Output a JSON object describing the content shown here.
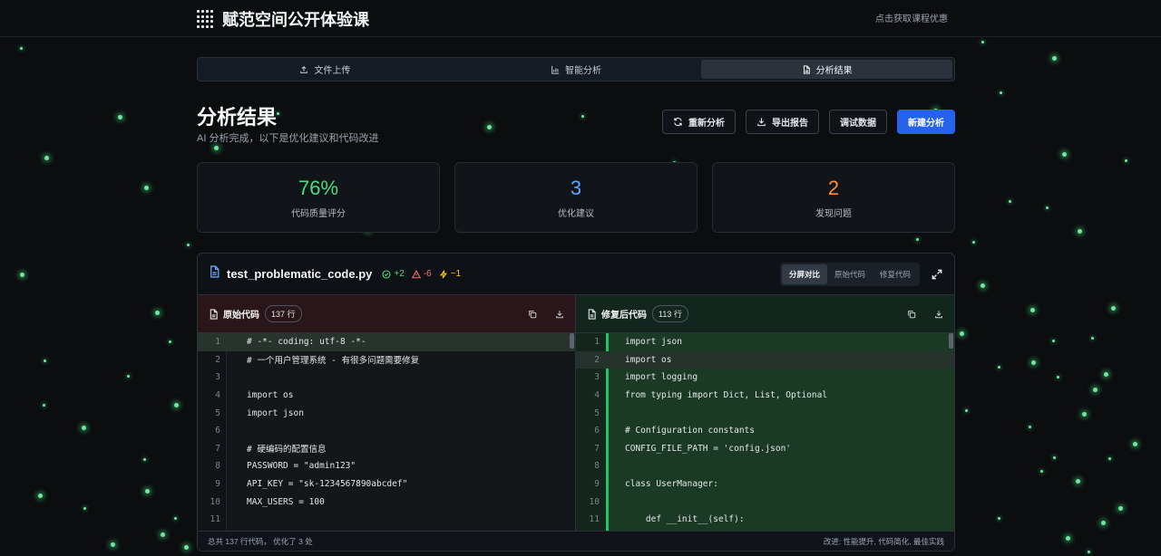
{
  "header": {
    "title": "赋范空间公开体验课",
    "link": "点击获取课程优惠"
  },
  "steps": [
    {
      "label": "文件上传",
      "icon": "upload-icon"
    },
    {
      "label": "智能分析",
      "icon": "bar-chart-icon"
    },
    {
      "label": "分析结果",
      "icon": "document-icon",
      "active": true
    }
  ],
  "page": {
    "title": "分析结果",
    "subtitle": "AI 分析完成，以下是优化建议和代码改进"
  },
  "actions": {
    "reanalyze": "重新分析",
    "export": "导出报告",
    "debug": "调试数据",
    "new": "新建分析"
  },
  "stats": [
    {
      "value": "76%",
      "label": "代码质量评分",
      "color": "#4ade80"
    },
    {
      "value": "3",
      "label": "优化建议",
      "color": "#60a5fa"
    },
    {
      "value": "2",
      "label": "发现问题",
      "color": "#fb923c"
    }
  ],
  "file": {
    "name": "test_problematic_code.py",
    "added": "+2",
    "removed": "-6",
    "changed": "~1",
    "views": [
      "分屏对比",
      "原始代码",
      "修复代码"
    ]
  },
  "left": {
    "title": "原始代码",
    "lines_badge": "137 行",
    "lines": [
      {
        "n": "1",
        "t": "# -*- coding: utf-8 -*-"
      },
      {
        "n": "2",
        "t": "# 一个用户管理系统 - 有很多问题需要修复"
      },
      {
        "n": "3",
        "t": ""
      },
      {
        "n": "4",
        "t": "import os"
      },
      {
        "n": "5",
        "t": "import json"
      },
      {
        "n": "6",
        "t": ""
      },
      {
        "n": "7",
        "t": "# 硬编码的配置信息"
      },
      {
        "n": "8",
        "t": "PASSWORD = \"admin123\""
      },
      {
        "n": "9",
        "t": "API_KEY = \"sk-1234567890abcdef\""
      },
      {
        "n": "10",
        "t": "MAX_USERS = 100"
      },
      {
        "n": "11",
        "t": ""
      }
    ]
  },
  "right": {
    "title": "修复后代码",
    "lines_badge": "113 行",
    "lines": [
      {
        "n": "1",
        "t": "import json"
      },
      {
        "n": "2",
        "t": "import os"
      },
      {
        "n": "3",
        "t": "import logging"
      },
      {
        "n": "4",
        "t": "from typing import Dict, List, Optional"
      },
      {
        "n": "5",
        "t": ""
      },
      {
        "n": "6",
        "t": "# Configuration constants"
      },
      {
        "n": "7",
        "t": "CONFIG_FILE_PATH = 'config.json'"
      },
      {
        "n": "8",
        "t": ""
      },
      {
        "n": "9",
        "t": "class UserManager:"
      },
      {
        "n": "10",
        "t": ""
      },
      {
        "n": "11",
        "t": "    def __init__(self):"
      }
    ]
  },
  "footer": {
    "left": "总共 137 行代码，  优化了 3 处",
    "right": "改进: 性能提升, 代码简化, 最佳实践"
  }
}
